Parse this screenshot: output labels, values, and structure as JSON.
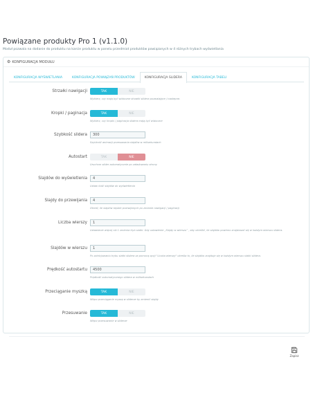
{
  "page": {
    "title": "Powiązane produkty Pro 1 (v1.1.0)",
    "description": "Moduł pozwala na dodanie do produktu na karcie produktu w panelu przedmiot produktów powiązanych w 4 różnych trybach wyświetlania"
  },
  "panel": {
    "heading": "KONFIGURACJA MODUŁU",
    "tabs": [
      {
        "label": "KONFIGURACJA WYŚWIETLANIA",
        "active": false
      },
      {
        "label": "KONFIGURACJA POWIĄZAŃ PRODUKTÓW",
        "active": false
      },
      {
        "label": "KONFIGURACJA SLIDERA",
        "active": true
      },
      {
        "label": "KONFIGURACJA TABELI",
        "active": false
      }
    ]
  },
  "fields": {
    "arrows": {
      "label": "Strzałki nawigacji",
      "on": "TAK",
      "off": "NIE",
      "value": "on",
      "help": "Wybierz, czy mają być widoczne strzałki slidera pozwalające / nastepne."
    },
    "dots": {
      "label": "Kropki / paginacja",
      "on": "TAK",
      "off": "NIE",
      "value": "on",
      "help": "Wybierz, czy kropki / paginacja slidera mają być widoczne"
    },
    "speed": {
      "label": "Szybkość slidera",
      "value": "300",
      "help": "Szybkość animacji przesuwania slajdów w milisekundach"
    },
    "autostart": {
      "label": "Autostart",
      "on": "TAK",
      "off": "NIE",
      "value": "off",
      "help": "Uruchom slider automatycznie po załadowaniu strony"
    },
    "slides_show": {
      "label": "Slajdów do wyświetlenia",
      "value": "4",
      "help": "Ustaw ilość slajdów do wyświetlenia"
    },
    "slides_scroll": {
      "label": "Slajdy do przewijania",
      "value": "4",
      "help": "Określ, ile slajdów będzie przewijanych po zmianie nawigacji / paginacji"
    },
    "rows": {
      "label": "Liczba wierszy",
      "value": "1",
      "help": "Ustawienie więcej niż 1 zmienia tryb siatki. Gdy ustawienie „Slajdy w wierszu” , aby określić, ile slajdów powinno znajdować się w każdym wierszu slidera."
    },
    "slides_per_row": {
      "label": "Slajdów w wierszu",
      "value": "1",
      "help": "Po zainicjowaniu trybu siatki slidera za pomocą opcji \"Liczba wierszy\" określa to, ile slajdów znajduje się w każdym wierszu siatki slidera."
    },
    "autoplay_speed": {
      "label": "Prędkość autostartu",
      "value": "4500",
      "help": "Prędkość automatycznego slidera w milisekundach"
    },
    "drag": {
      "label": "Przeciąganie myszką",
      "on": "TAK",
      "off": "NIE",
      "value": "on",
      "help": "Włącz przeciąganie myszą w sliderze by zmienić slajdy"
    },
    "swipe": {
      "label": "Przesuwanie",
      "on": "TAK",
      "off": "NIE",
      "value": "on",
      "help": "Włącz przesuwanie w sliderze"
    }
  },
  "footer": {
    "save_label": "Zapisz"
  },
  "colors": {
    "accent": "#25b9d7",
    "no_active": "#e08f95"
  }
}
